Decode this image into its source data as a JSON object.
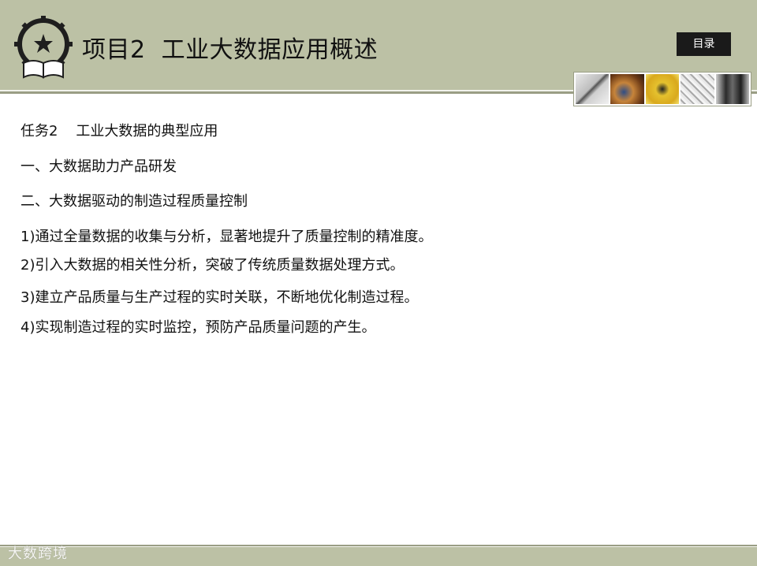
{
  "header": {
    "title": "项目2  工业大数据应用概述",
    "menu_button": "目录"
  },
  "content": {
    "lines": [
      "任务2    工业大数据的典型应用",
      "一、大数据助力产品研发",
      "二、大数据驱动的制造过程质量控制",
      "1)通过全量数据的收集与分析，显著地提升了质量控制的精准度。",
      "2)引入大数据的相关性分析，突破了传统质量数据处理方式。",
      "3)建立产品质量与生产过程的实时关联，不断地优化制造过程。",
      "4)实现制造过程的实时监控，预防产品质量问题的产生。"
    ]
  },
  "footer": {
    "watermark": "大数跨境"
  },
  "colors": {
    "header_bg": "#bcc1a5",
    "button_bg": "#1a1a1a"
  },
  "icons": [
    "gear-star-book-emblem",
    "banner-photo"
  ]
}
